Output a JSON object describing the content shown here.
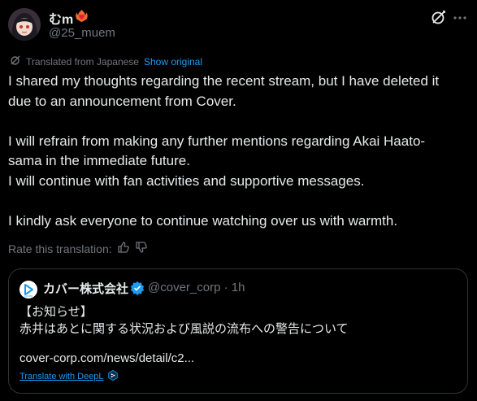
{
  "author": {
    "display_name": "むm",
    "handle": "@25_muem",
    "emoji_icon": "fire-heart-icon"
  },
  "translation": {
    "label": "Translated from Japanese",
    "show_original": "Show original"
  },
  "post": {
    "paragraphs": [
      [
        "I shared my thoughts regarding the recent stream, but I have deleted it",
        "due to an announcement from Cover."
      ],
      [
        "I will refrain from making any further mentions regarding Akai Haato-",
        "sama in the immediate future.",
        "I will continue with fan activities and supportive messages."
      ],
      [
        "I kindly ask everyone to continue watching over us with warmth."
      ]
    ]
  },
  "rating": {
    "label": "Rate this translation:"
  },
  "quote": {
    "name": "カバー株式会社",
    "handle_time": "@cover_corp · 1h",
    "line1": "【お知らせ】",
    "line2": "赤井はあとに関する状況および風説の流布への警告について",
    "link": "cover-corp.com/news/detail/c2...",
    "deepl": "Translate with DeepL"
  },
  "colors": {
    "background": "#000000",
    "text": "#e7e9ea",
    "muted": "#71767b",
    "accent": "#1d9bf0",
    "border": "#2f3336"
  }
}
